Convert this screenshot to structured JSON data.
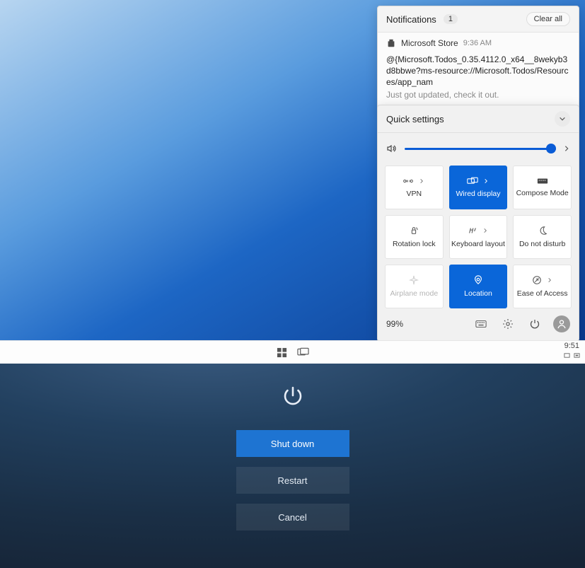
{
  "notifications": {
    "title": "Notifications",
    "count": "1",
    "clear_all_label": "Clear all",
    "item": {
      "app": "Microsoft Store",
      "time": "9:36 AM",
      "body_line": "@{Microsoft.Todos_0.35.4112.0_x64__8wekyb3d8bbwe?ms-resource://Microsoft.Todos/Resources/app_nam",
      "sub": "Just got updated, check it out."
    }
  },
  "quick_settings": {
    "title": "Quick settings",
    "tiles": {
      "vpn": "VPN",
      "wired": "Wired display",
      "compose": "Compose Mode",
      "rotation": "Rotation lock",
      "keyboard": "Keyboard layout",
      "dnd": "Do not disturb",
      "airplane": "Airplane mode",
      "location": "Location",
      "ease": "Ease of Access"
    },
    "battery": "99%"
  },
  "taskbar": {
    "clock": "9:51"
  },
  "power_menu": {
    "shut_down": "Shut down",
    "restart": "Restart",
    "cancel": "Cancel"
  }
}
